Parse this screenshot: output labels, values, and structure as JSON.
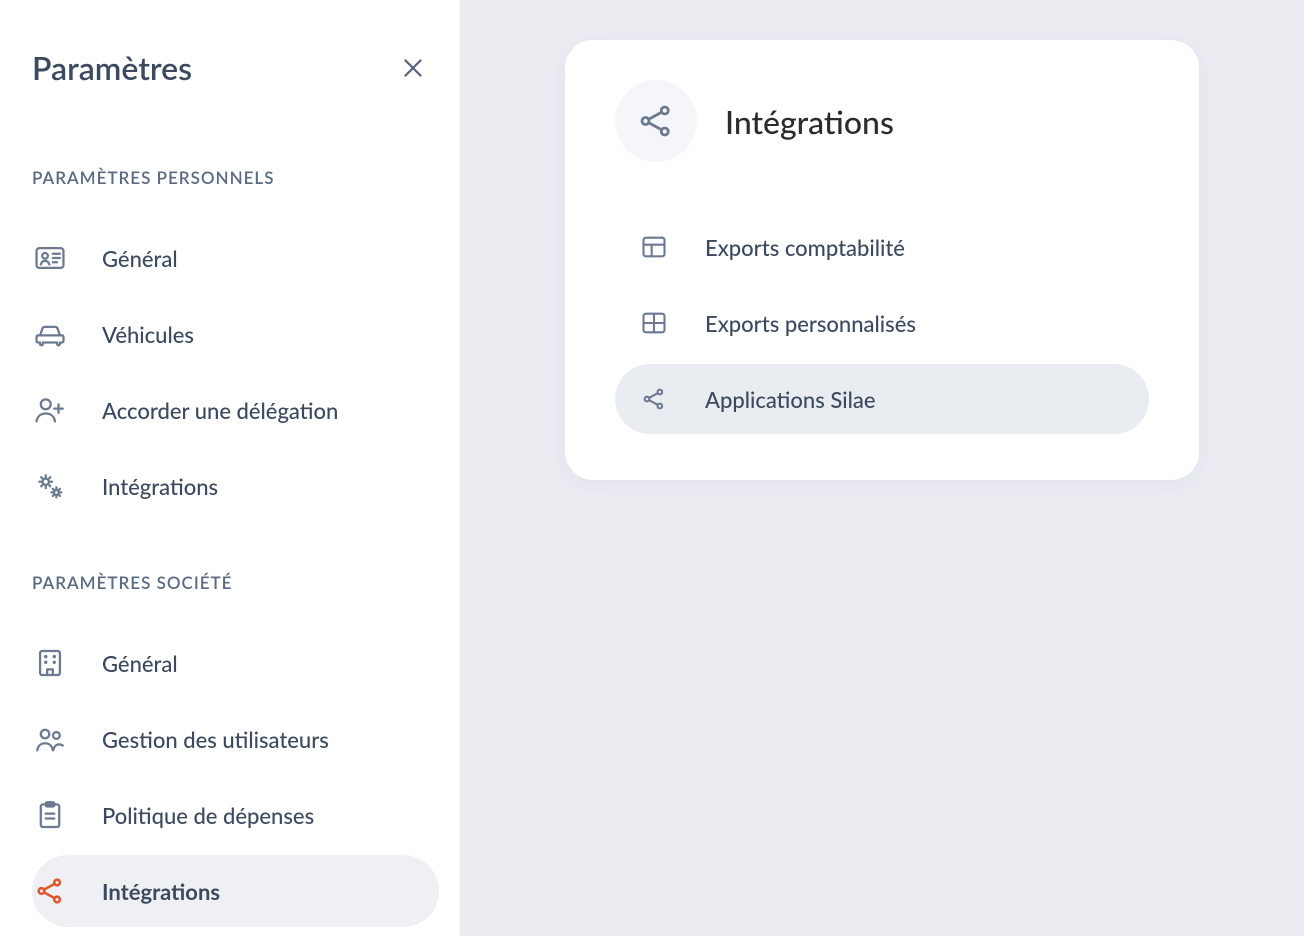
{
  "sidebar": {
    "title": "Paramètres",
    "sections": {
      "personal": {
        "label": "PARAMÈTRES PERSONNELS",
        "items": {
          "general": {
            "label": "Général"
          },
          "vehicles": {
            "label": "Véhicules"
          },
          "delegation": {
            "label": "Accorder une délégation"
          },
          "integrations": {
            "label": "Intégrations"
          }
        }
      },
      "company": {
        "label": "PARAMÈTRES SOCIÉTÉ",
        "items": {
          "general": {
            "label": "Général"
          },
          "users": {
            "label": "Gestion des utilisateurs"
          },
          "policy": {
            "label": "Politique de dépenses"
          },
          "integrations": {
            "label": "Intégrations"
          }
        }
      }
    }
  },
  "card": {
    "title": "Intégrations",
    "items": {
      "accounting": {
        "label": "Exports comptabilité"
      },
      "custom": {
        "label": "Exports personnalisés"
      },
      "silae": {
        "label": "Applications Silae"
      }
    }
  }
}
